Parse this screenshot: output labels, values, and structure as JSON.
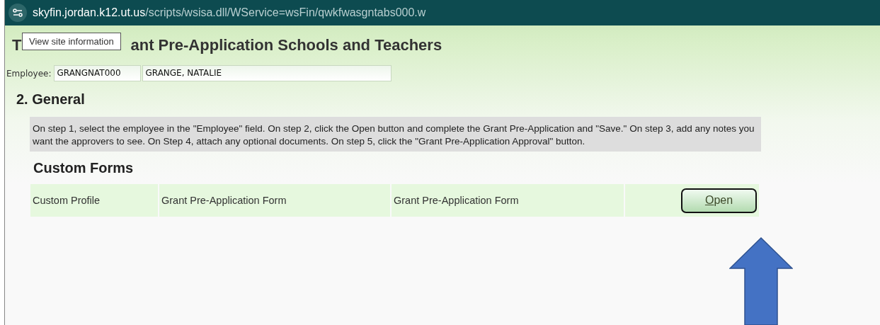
{
  "address_bar": {
    "host": "skyfin.jordan.k12.ut.us",
    "path": "/scripts/wsisa.dll/WService=wsFin/qwkfwasgntabs000.w"
  },
  "tooltip": {
    "text": "View site information"
  },
  "title": {
    "visible_start": "T",
    "visible_end": "ant Pre-Application Schools and Teachers"
  },
  "employee": {
    "label": "Employee:",
    "id": "GRANGNAT000",
    "name": "GRANGE, NATALIE"
  },
  "section": {
    "heading": "2. General",
    "instructions": "On step 1, select the employee in the \"Employee\" field. On step 2, click the Open button and complete the Grant Pre-Application and \"Save.\" On step 3, add any notes you want the approvers to see. On Step 4, attach any optional documents. On step 5, click the \"Grant Pre-Application Approval\" button."
  },
  "custom_forms": {
    "heading": "Custom Forms",
    "rows": [
      {
        "column_1": "Custom Profile",
        "column_2": "Grant Pre-Application Form",
        "column_3": "Grant Pre-Application Form",
        "button": "Open"
      }
    ]
  }
}
